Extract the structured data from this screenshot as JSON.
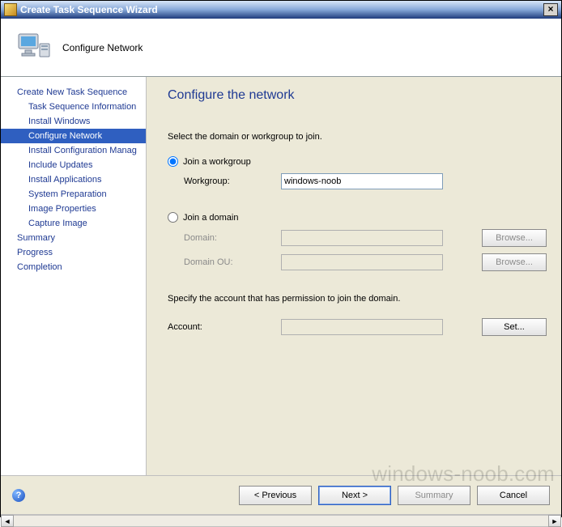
{
  "window": {
    "title": "Create Task Sequence Wizard",
    "close_glyph": "×"
  },
  "header": {
    "step_title": "Configure Network"
  },
  "sidebar": {
    "root": "Create New Task Sequence",
    "items": [
      "Task Sequence Information",
      "Install Windows",
      "Configure Network",
      "Install Configuration Manag",
      "Include Updates",
      "Install Applications",
      "System Preparation",
      "Image Properties",
      "Capture Image"
    ],
    "tail": [
      "Summary",
      "Progress",
      "Completion"
    ],
    "selected_index": 2
  },
  "content": {
    "heading": "Configure the network",
    "instruction": "Select the domain or workgroup to join.",
    "opt_workgroup": "Join a workgroup",
    "label_workgroup": "Workgroup:",
    "value_workgroup": "windows-noob",
    "opt_domain": "Join a domain",
    "label_domain": "Domain:",
    "value_domain": "",
    "label_domain_ou": "Domain OU:",
    "value_domain_ou": "",
    "browse": "Browse...",
    "account_instruction": "Specify the account that has permission to join the domain.",
    "label_account": "Account:",
    "value_account": "",
    "set": "Set..."
  },
  "footer": {
    "help_glyph": "?",
    "previous": "< Previous",
    "next": "Next >",
    "summary": "Summary",
    "cancel": "Cancel"
  },
  "scrollbar": {
    "left_glyph": "◄",
    "right_glyph": "►"
  },
  "watermark": "windows-noob.com"
}
